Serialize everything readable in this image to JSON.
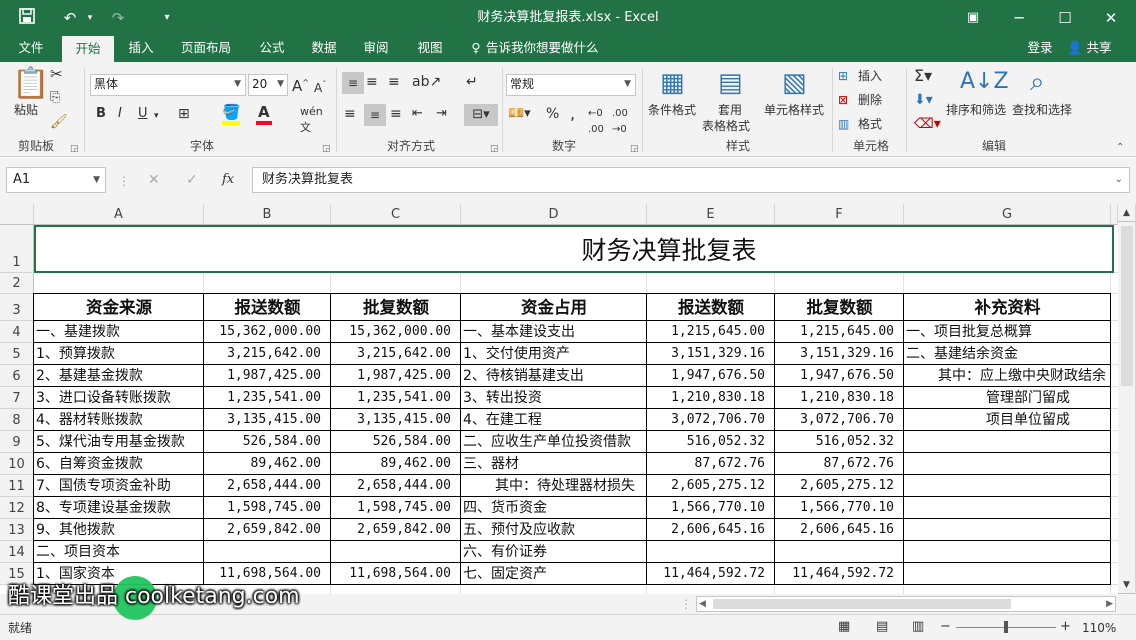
{
  "window": {
    "title": "财务决算批复报表.xlsx - Excel"
  },
  "tabs": [
    "文件",
    "开始",
    "插入",
    "页面布局",
    "公式",
    "数据",
    "审阅",
    "视图"
  ],
  "active_tab": "开始",
  "tellme": "告诉我你想要做什么",
  "login": "登录",
  "share": "共享",
  "ribbon": {
    "clipboard": {
      "label": "剪贴板",
      "paste": "粘贴"
    },
    "font": {
      "label": "字体",
      "name": "黑体",
      "size": "20"
    },
    "alignment": {
      "label": "对齐方式"
    },
    "number": {
      "label": "数字",
      "format": "常规"
    },
    "styles": {
      "label": "样式",
      "conditional": "条件格式",
      "table1": "套用",
      "table2": "表格格式",
      "cell_styles": "单元格样式"
    },
    "cells": {
      "label": "单元格",
      "insert": "插入",
      "delete": "删除",
      "format": "格式"
    },
    "editing": {
      "label": "编辑",
      "sort": "排序和筛选",
      "find": "查找和选择"
    }
  },
  "formula_bar": {
    "name_box": "A1",
    "fx": "fx",
    "content": "财务决算批复表"
  },
  "sheet": {
    "columns": [
      "A",
      "B",
      "C",
      "D",
      "E",
      "F",
      "G"
    ],
    "rows": [
      "1",
      "2",
      "3",
      "4",
      "5",
      "6",
      "7",
      "8",
      "9",
      "10",
      "11",
      "12",
      "13",
      "14",
      "15"
    ],
    "title": "财务决算批复表",
    "headers": [
      "资金来源",
      "报送数额",
      "批复数额",
      "资金占用",
      "报送数额",
      "批复数额",
      "补充资料"
    ],
    "data": [
      [
        "一、基建拨款",
        "15,362,000.00",
        "15,362,000.00",
        "一、基本建设支出",
        "1,215,645.00",
        "1,215,645.00",
        "一、项目批复总概算"
      ],
      [
        "  1、预算拨款",
        "3,215,642.00",
        "3,215,642.00",
        "  1、交付使用资产",
        "3,151,329.16",
        "3,151,329.16",
        "二、基建结余资金"
      ],
      [
        "  2、基建基金拨款",
        "1,987,425.00",
        "1,987,425.00",
        "  2、待核销基建支出",
        "1,947,676.50",
        "1,947,676.50",
        "其中：应上缴中央财政结余"
      ],
      [
        "  3、进口设备转账拨款",
        "1,235,541.00",
        "1,235,541.00",
        "  3、转出投资",
        "1,210,830.18",
        "1,210,830.18",
        "管理部门留成"
      ],
      [
        "  4、器材转账拨款",
        "3,135,415.00",
        "3,135,415.00",
        "  4、在建工程",
        "3,072,706.70",
        "3,072,706.70",
        "项目单位留成"
      ],
      [
        "  5、煤代油专用基金拨款",
        "526,584.00",
        "526,584.00",
        "二、应收生产单位投资借款",
        "516,052.32",
        "516,052.32",
        ""
      ],
      [
        "  6、自筹资金拨款",
        "89,462.00",
        "89,462.00",
        "三、器材",
        "87,672.76",
        "87,672.76",
        ""
      ],
      [
        "  7、国债专项资金补助",
        "2,658,444.00",
        "2,658,444.00",
        "其中：待处理器材损失",
        "2,605,275.12",
        "2,605,275.12",
        ""
      ],
      [
        "  8、专项建设基金拨款",
        "1,598,745.00",
        "1,598,745.00",
        "四、货币资金",
        "1,566,770.10",
        "1,566,770.10",
        ""
      ],
      [
        "  9、其他拨款",
        "2,659,842.00",
        "2,659,842.00",
        "五、预付及应收款",
        "2,606,645.16",
        "2,606,645.16",
        ""
      ],
      [
        "二、项目资本",
        "",
        "",
        "六、有价证券",
        "",
        "",
        ""
      ],
      [
        "  1、国家资本",
        "11,698,564.00",
        "11,698,564.00",
        "七、固定资产",
        "11,464,592.72",
        "11,464,592.72",
        ""
      ]
    ]
  },
  "status": {
    "ready": "就绪",
    "zoom": "110%"
  },
  "watermark": {
    "text": "酷课堂出品 coolketang.com"
  }
}
